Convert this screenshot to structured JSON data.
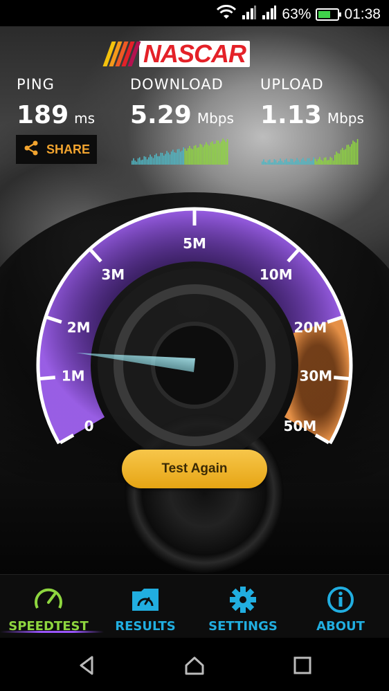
{
  "status_bar": {
    "battery_percent": "63%",
    "time": "01:38",
    "battery_level": 0.63,
    "battery_color": "#3fd14a"
  },
  "header": {
    "logo_text": "NASCAR",
    "logo_stripe_colors": [
      "#f4c20d",
      "#f59a1b",
      "#ee5a24",
      "#e42128",
      "#b3124f"
    ]
  },
  "stats": {
    "ping": {
      "label": "PING",
      "value": "189",
      "unit": "ms"
    },
    "download": {
      "label": "DOWNLOAD",
      "value": "5.29",
      "unit": "Mbps"
    },
    "upload": {
      "label": "UPLOAD",
      "value": "1.13",
      "unit": "Mbps"
    }
  },
  "share": {
    "label": "SHARE",
    "icon": "share-icon"
  },
  "gauge": {
    "ticks": [
      "0",
      "1M",
      "2M",
      "3M",
      "5M",
      "10M",
      "20M",
      "30M",
      "50M"
    ],
    "needle_value": "1.13",
    "purple": "#8e4fd6",
    "orange": "#e7853a"
  },
  "actions": {
    "test_again": "Test Again"
  },
  "nav": {
    "items": [
      {
        "label": "SPEEDTEST",
        "icon": "speedometer-icon"
      },
      {
        "label": "RESULTS",
        "icon": "folder-icon"
      },
      {
        "label": "SETTINGS",
        "icon": "gear-icon"
      },
      {
        "label": "ABOUT",
        "icon": "info-icon"
      }
    ],
    "active_color": "#8ed63f",
    "inactive_color": "#21aee0"
  },
  "system_nav": {
    "back": "back-icon",
    "home": "home-icon",
    "recents": "recents-icon"
  }
}
